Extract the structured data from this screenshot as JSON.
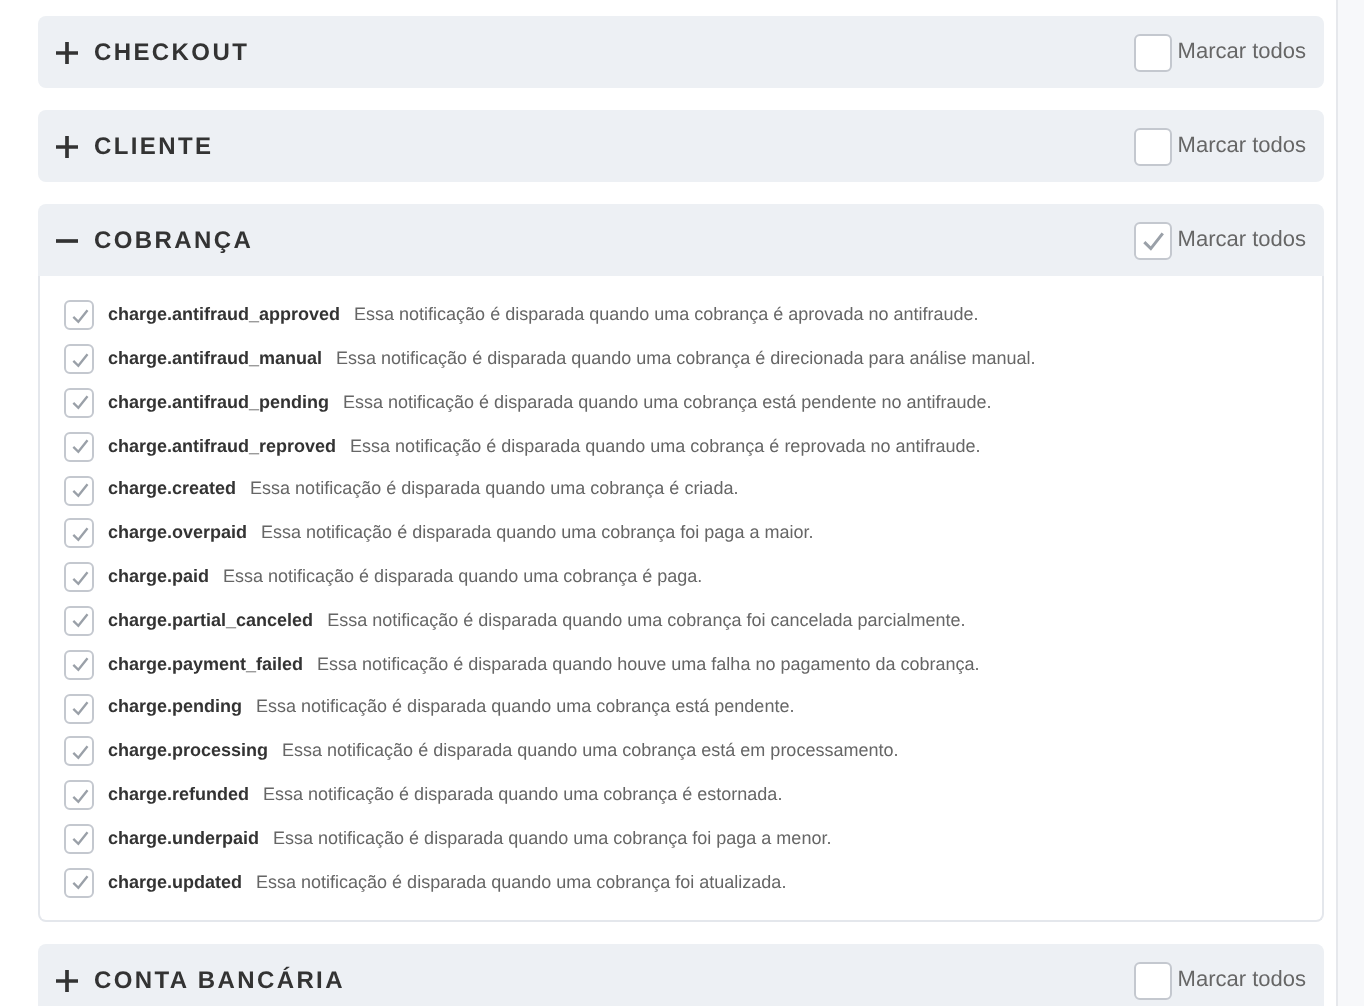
{
  "sections": [
    {
      "title": "CHECKOUT",
      "expanded": false,
      "select_all": {
        "label": "Marcar todos",
        "checked": false
      }
    },
    {
      "title": "CLIENTE",
      "expanded": false,
      "select_all": {
        "label": "Marcar todos",
        "checked": false
      }
    },
    {
      "title": "COBRANÇA",
      "expanded": true,
      "select_all": {
        "label": "Marcar todos",
        "checked": true
      },
      "items": [
        {
          "name": "charge.antifraud_approved",
          "description": "Essa notificação é disparada quando uma cobrança é aprovada no antifraude.",
          "checked": true
        },
        {
          "name": "charge.antifraud_manual",
          "description": "Essa notificação é disparada quando uma cobrança é direcionada para análise manual.",
          "checked": true
        },
        {
          "name": "charge.antifraud_pending",
          "description": "Essa notificação é disparada quando uma cobrança está pendente no antifraude.",
          "checked": true
        },
        {
          "name": "charge.antifraud_reproved",
          "description": "Essa notificação é disparada quando uma cobrança é reprovada no antifraude.",
          "checked": true
        },
        {
          "name": "charge.created",
          "description": "Essa notificação é disparada quando uma cobrança é criada.",
          "checked": true
        },
        {
          "name": "charge.overpaid",
          "description": "Essa notificação é disparada quando uma cobrança foi paga a maior.",
          "checked": true
        },
        {
          "name": "charge.paid",
          "description": "Essa notificação é disparada quando uma cobrança é paga.",
          "checked": true
        },
        {
          "name": "charge.partial_canceled",
          "description": "Essa notificação é disparada quando uma cobrança foi cancelada parcialmente.",
          "checked": true
        },
        {
          "name": "charge.payment_failed",
          "description": "Essa notificação é disparada quando houve uma falha no pagamento da cobrança.",
          "checked": true
        },
        {
          "name": "charge.pending",
          "description": "Essa notificação é disparada quando uma cobrança está pendente.",
          "checked": true
        },
        {
          "name": "charge.processing",
          "description": "Essa notificação é disparada quando uma cobrança está em processamento.",
          "checked": true
        },
        {
          "name": "charge.refunded",
          "description": "Essa notificação é disparada quando uma cobrança é estornada.",
          "checked": true
        },
        {
          "name": "charge.underpaid",
          "description": "Essa notificação é disparada quando uma cobrança foi paga a menor.",
          "checked": true
        },
        {
          "name": "charge.updated",
          "description": "Essa notificação é disparada quando uma cobrança foi atualizada.",
          "checked": true
        }
      ]
    },
    {
      "title": "CONTA BANCÁRIA",
      "expanded": false,
      "select_all": {
        "label": "Marcar todos",
        "checked": false
      }
    }
  ]
}
